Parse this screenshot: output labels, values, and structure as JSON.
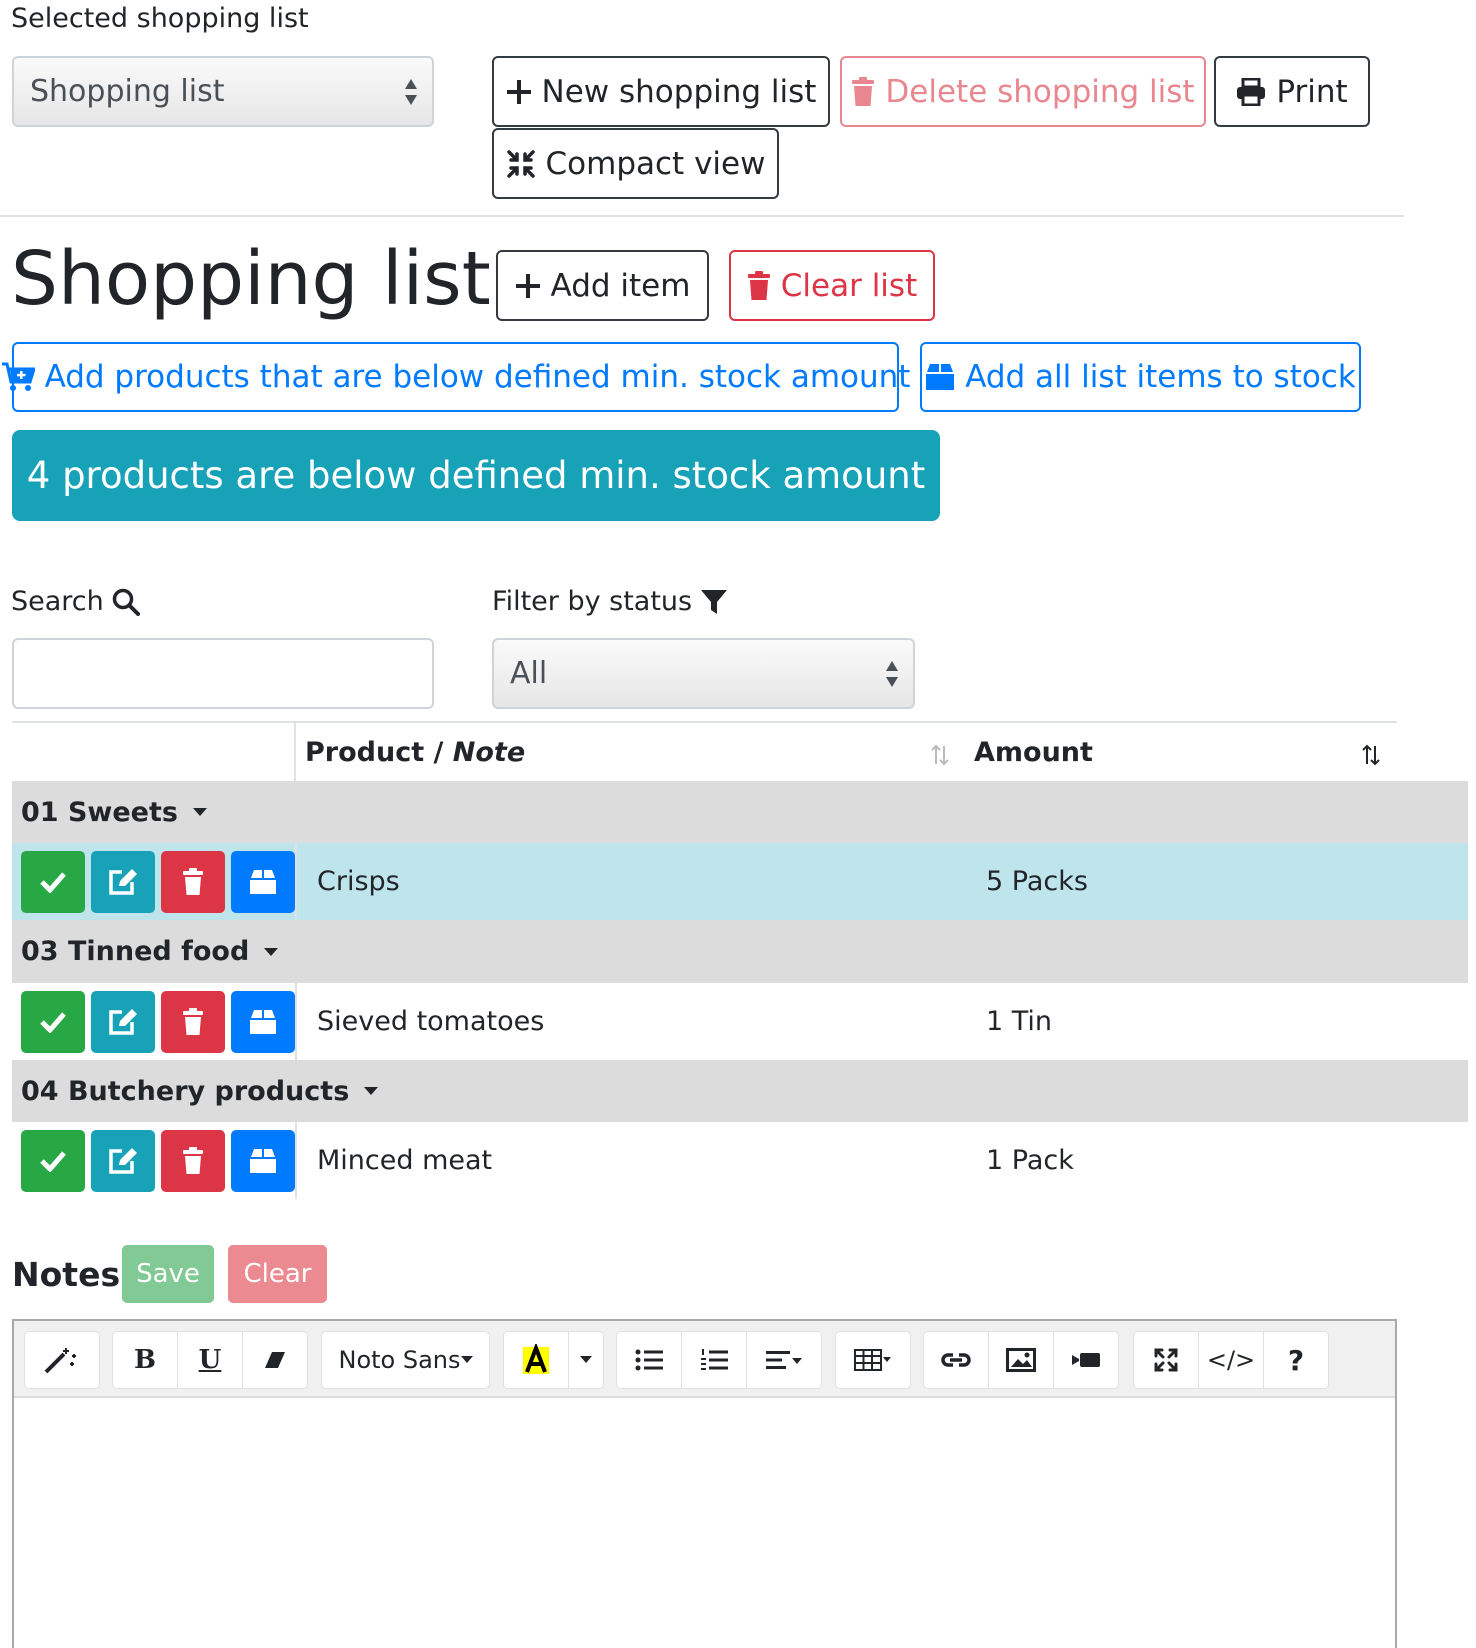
{
  "top": {
    "selected_list_label": "Selected shopping list",
    "selected_list_value": "Shopping list",
    "new_list_label": "New shopping list",
    "delete_list_label": "Delete shopping list",
    "print_label": "Print",
    "compact_view_label": "Compact view"
  },
  "page": {
    "title": "Shopping list",
    "add_item_label": "Add item",
    "clear_list_label": "Clear list",
    "add_below_min_label": "Add products that are below defined min. stock amount",
    "add_all_to_stock_label": "Add all list items to stock",
    "below_min_alert": "4 products are below defined min. stock amount"
  },
  "filters": {
    "search_label": "Search",
    "search_value": "",
    "status_label": "Filter by status",
    "status_value": "All"
  },
  "table": {
    "col_product": "Product / ",
    "col_note": "Note",
    "col_amount": "Amount",
    "groups": [
      {
        "name": "01 Sweets",
        "items": [
          {
            "product": "Crisps",
            "amount": "5 Packs",
            "highlight": true
          }
        ]
      },
      {
        "name": "03 Tinned food",
        "items": [
          {
            "product": "Sieved tomatoes",
            "amount": "1 Tin",
            "highlight": false
          }
        ]
      },
      {
        "name": "04 Butchery products",
        "items": [
          {
            "product": "Minced meat",
            "amount": "1 Pack",
            "highlight": false
          }
        ]
      }
    ]
  },
  "notes": {
    "title": "Notes",
    "save_label": "Save",
    "clear_label": "Clear",
    "font_name": "Noto Sans",
    "toolbar_text": {
      "bold": "B",
      "underline": "U",
      "code": "</>",
      "help": "?"
    }
  },
  "colors": {
    "success": "#28a745",
    "info": "#17a2b8",
    "danger": "#dc3545",
    "primary": "#007bff",
    "alert": "#17a2b8",
    "row_highlight": "#bee5eb",
    "group_bg": "#dcdcdc"
  }
}
